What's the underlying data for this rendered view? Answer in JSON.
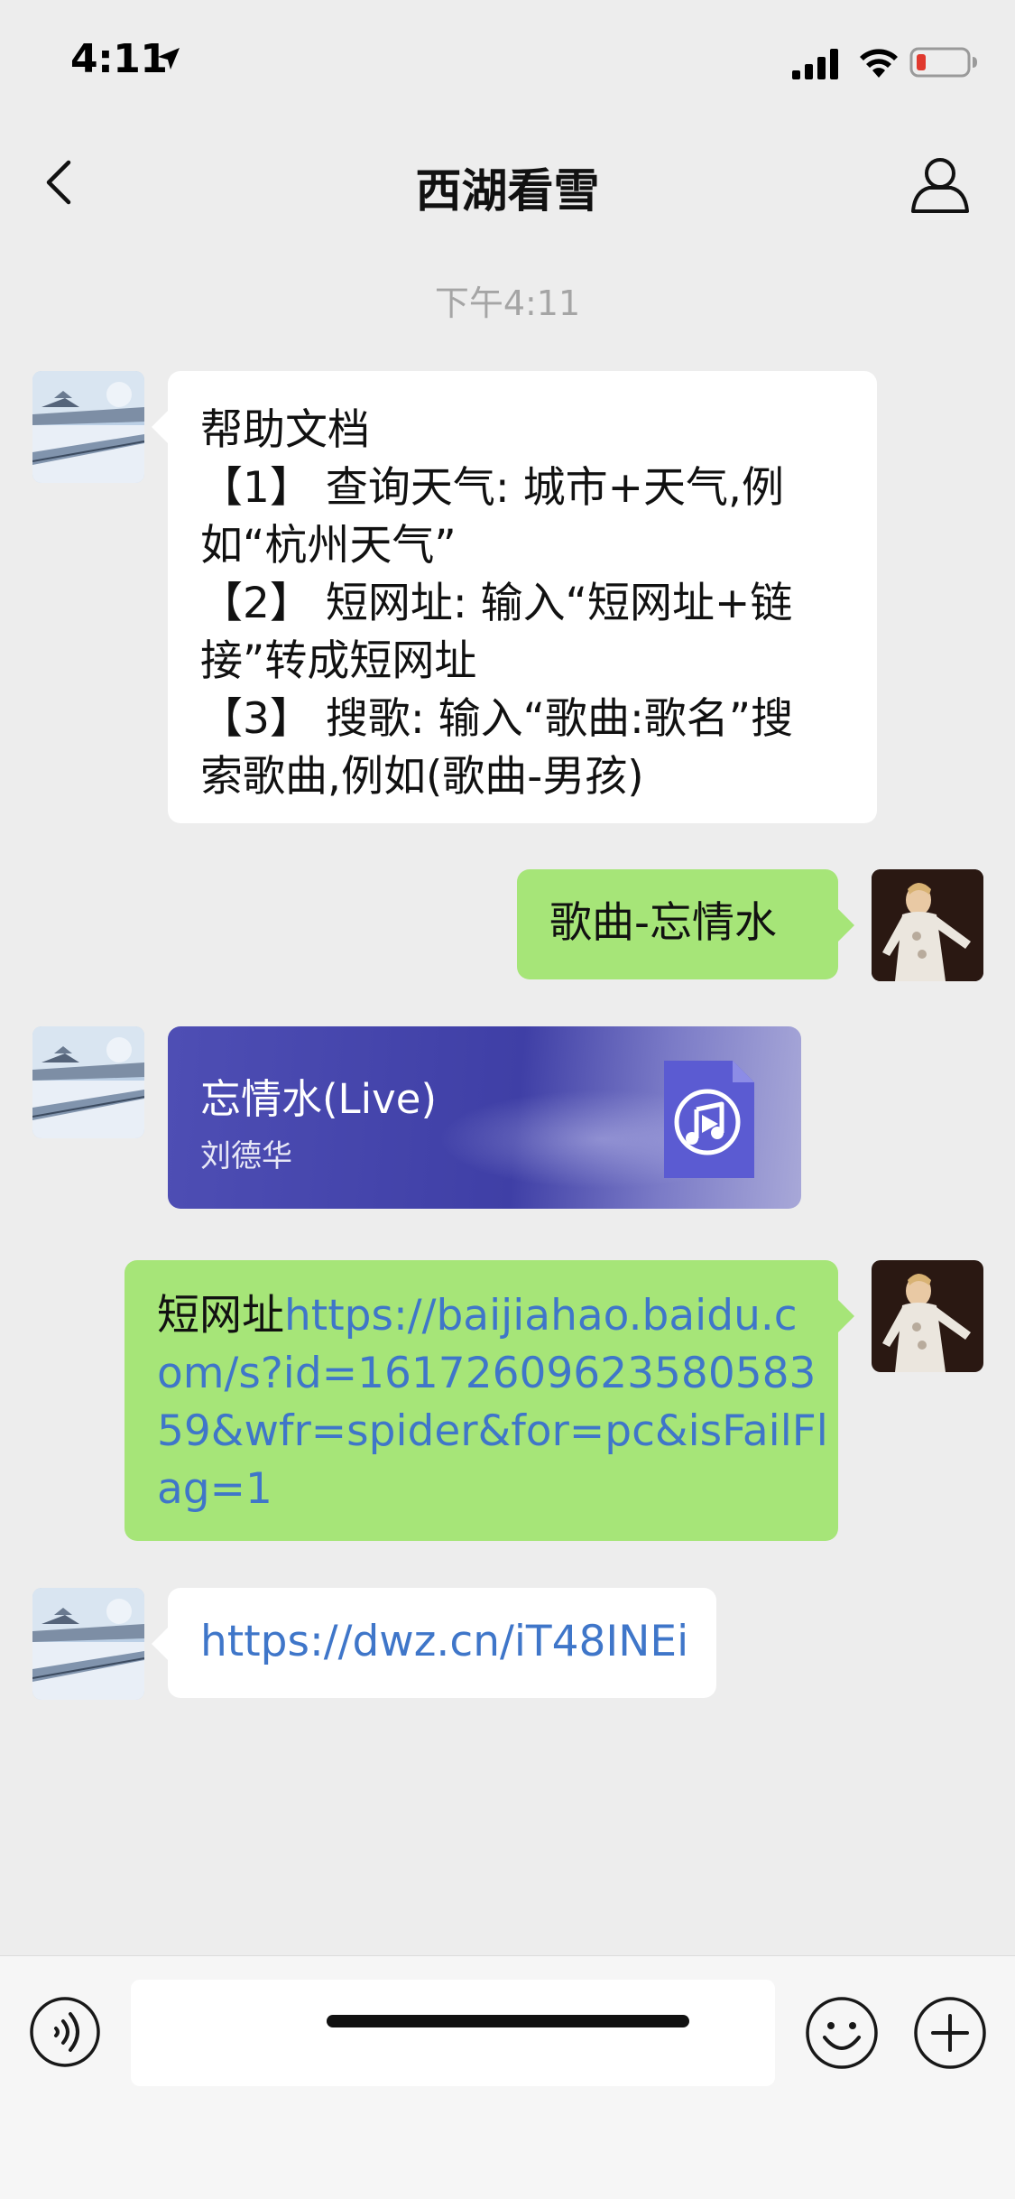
{
  "status_bar": {
    "time": "4:11"
  },
  "nav": {
    "title": "西湖看雪"
  },
  "timestamp": "下午4:11",
  "messages": {
    "help": {
      "lines": [
        "帮助文档",
        "【1】 查询天气: 城市+天气,例",
        "如“杭州天气”",
        "【2】 短网址: 输入“短网址+链",
        "接”转成短网址",
        "【3】 搜歌: 输入“歌曲:歌名”搜",
        "索歌曲,例如(歌曲-男孩)"
      ]
    },
    "song_request": {
      "text": "歌曲-忘情水"
    },
    "music_card": {
      "title": "忘情水(Live)",
      "artist": "刘德华"
    },
    "short_url_request": {
      "prefix": "短网址",
      "link_lines": [
        "https://baijiahao.baidu.c",
        "om/s?id=16172609623580583",
        "59&wfr=spider&for=pc&isFailFl",
        "ag=1"
      ],
      "first_link_segment": "https://baijiahao.baidu.c"
    },
    "short_url_reply": {
      "link": "https://dwz.cn/iT48INEi"
    }
  },
  "input_bar": {
    "placeholder": ""
  },
  "icons": {
    "location": "location-arrow-icon",
    "signal": "cellular-signal-icon",
    "wifi": "wifi-icon",
    "battery": "battery-low-icon",
    "back": "chevron-left-icon",
    "profile": "person-icon",
    "voice": "voice-icon",
    "emoji": "emoji-icon",
    "plus": "plus-circle-icon",
    "music": "music-file-icon"
  },
  "colors": {
    "background": "#ededed",
    "bubble_green": "#a6e578",
    "bubble_white": "#ffffff",
    "link": "#3f76c9",
    "battery_low": "#e0392e",
    "music_card": "#4545aa"
  }
}
